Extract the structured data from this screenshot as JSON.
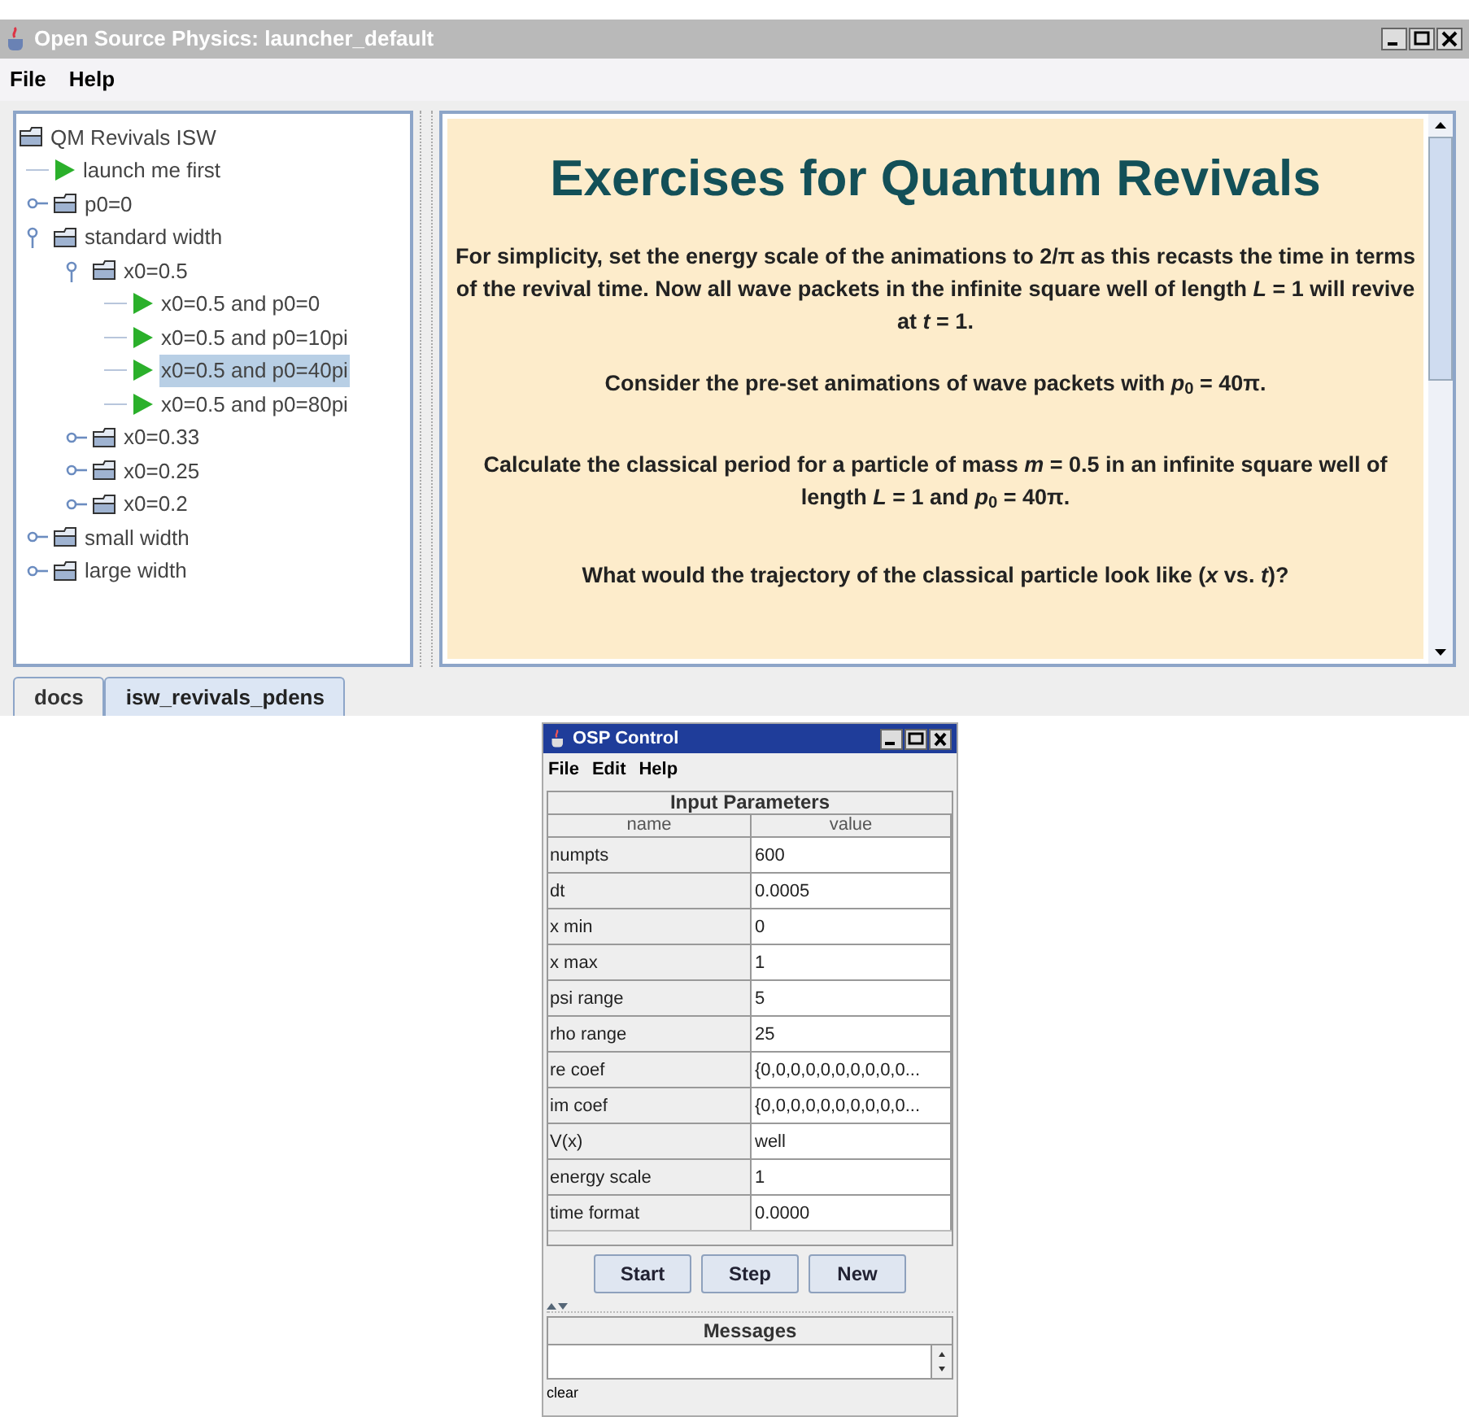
{
  "window": {
    "title": "Open Source Physics: launcher_default"
  },
  "menu": [
    "File",
    "Help"
  ],
  "tree": [
    {
      "label": "QM Revivals ISW",
      "kind": "folder",
      "selected": false,
      "children": [
        {
          "label": "launch me first",
          "kind": "launch",
          "selected": false
        },
        {
          "label": "p0=0",
          "kind": "folder",
          "expanded": false,
          "selected": false
        },
        {
          "label": "standard width",
          "kind": "folder",
          "expanded": true,
          "selected": false,
          "children": [
            {
              "label": "x0=0.5",
              "kind": "folder",
              "expanded": true,
              "selected": false,
              "children": [
                {
                  "label": "x0=0.5 and p0=0",
                  "kind": "launch",
                  "selected": false
                },
                {
                  "label": "x0=0.5 and p0=10pi",
                  "kind": "launch",
                  "selected": false
                },
                {
                  "label": "x0=0.5 and p0=40pi",
                  "kind": "launch",
                  "selected": true
                },
                {
                  "label": "x0=0.5 and p0=80pi",
                  "kind": "launch",
                  "selected": false
                }
              ]
            },
            {
              "label": "x0=0.33",
              "kind": "folder",
              "expanded": false,
              "selected": false
            },
            {
              "label": "x0=0.25",
              "kind": "folder",
              "expanded": false,
              "selected": false
            },
            {
              "label": "x0=0.2",
              "kind": "folder",
              "expanded": false,
              "selected": false
            }
          ]
        },
        {
          "label": "small width",
          "kind": "folder",
          "expanded": false,
          "selected": false
        },
        {
          "label": "large width",
          "kind": "folder",
          "expanded": false,
          "selected": false
        }
      ]
    }
  ],
  "document": {
    "heading": "Exercises for Quantum Revivals",
    "paragraphs": [
      "For simplicity, set the energy scale of the animations to 2/π as this recasts the time in terms of the revival time.  Now all wave packets in the infinite square well of length *L* = 1 will revive at *t* = 1.",
      "Consider the pre-set animations of wave packets with *p*$_{0}$ = 40π.",
      "Calculate the classical period for a particle of mass *m* = 0.5 in an infinite square well of length *L* = 1 and *p*$_{0}$ = 40π.",
      "What would the trajectory of the classical particle look like (*x* vs. *t*)?"
    ]
  },
  "tabs": [
    {
      "label": "docs",
      "selected": false
    },
    {
      "label": "isw_revivals_pdens",
      "selected": true
    }
  ],
  "control": {
    "title": "OSP Control",
    "menu": [
      "File",
      "Edit",
      "Help"
    ],
    "table_title": "Input Parameters",
    "columns": [
      "name",
      "value"
    ],
    "rows": [
      [
        "numpts",
        "600"
      ],
      [
        "dt",
        "0.0005"
      ],
      [
        "x min",
        "0"
      ],
      [
        "x max",
        "1"
      ],
      [
        "psi range",
        "5"
      ],
      [
        "rho range",
        "25"
      ],
      [
        "re coef",
        "{0,0,0,0,0,0,0,0,0,0..."
      ],
      [
        "im coef",
        "{0,0,0,0,0,0,0,0,0,0..."
      ],
      [
        "V(x)",
        "well"
      ],
      [
        "energy scale",
        "1"
      ],
      [
        "time format",
        "0.0000"
      ]
    ],
    "buttons": [
      "Start",
      "Step",
      "New"
    ],
    "messages_title": "Messages",
    "clear_label": "clear"
  }
}
